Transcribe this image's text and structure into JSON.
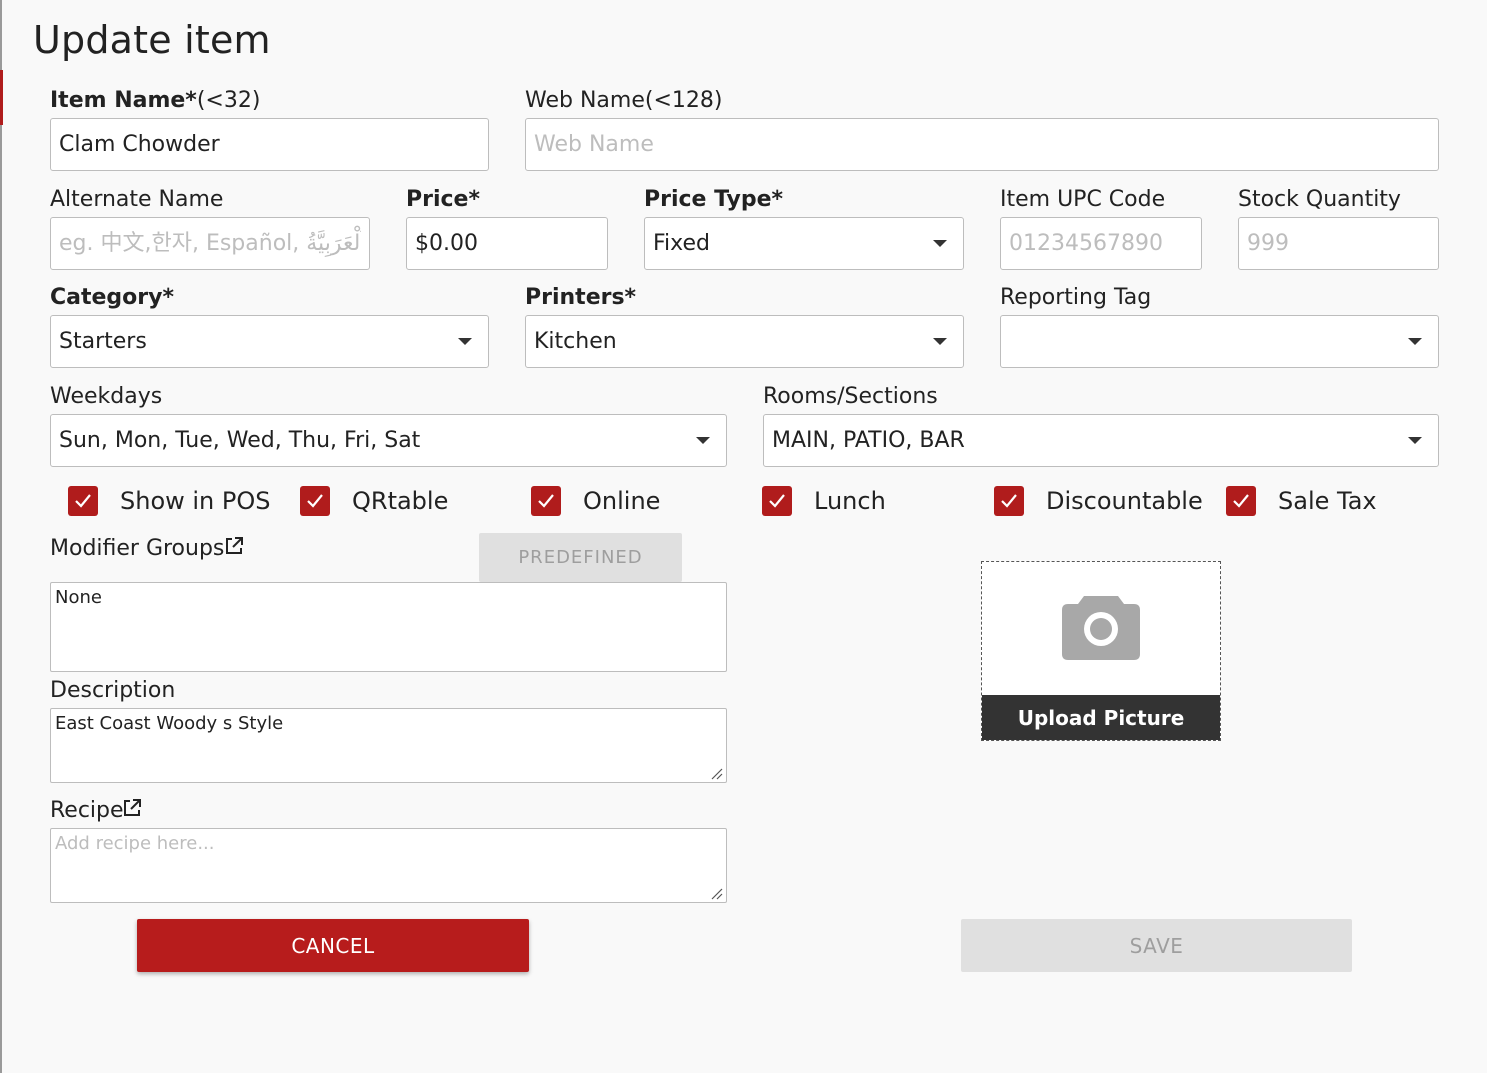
{
  "title": "Update item",
  "labels": {
    "item_name_bold": "Item Name*",
    "item_name_hint": "(<32)",
    "web_name": "Web Name(<128)",
    "alternate_name": "Alternate Name",
    "price": "Price*",
    "price_type": "Price Type*",
    "upc": "Item UPC Code",
    "stock": "Stock Quantity",
    "category": "Category*",
    "printers": "Printers*",
    "reporting_tag": "Reporting Tag",
    "weekdays": "Weekdays",
    "rooms": "Rooms/Sections",
    "modifier_groups": "Modifier Groups",
    "description": "Description",
    "recipe": "Recipe"
  },
  "fields": {
    "item_name": "Clam Chowder",
    "web_name_placeholder": "Web Name",
    "alternate_name_placeholder": "eg. 中文,한자, Español, اَلْعَرَبِيَّةُ",
    "price": "$0.00",
    "upc_placeholder": "01234567890",
    "stock_placeholder": "999",
    "price_type": "Fixed",
    "category": "Starters",
    "printers": "Kitchen",
    "reporting_tag": "",
    "weekdays": "Sun, Mon, Tue, Wed, Thu, Fri, Sat",
    "rooms": "MAIN, PATIO, BAR",
    "modifier_groups": "None",
    "description": "East Coast Woody s Style",
    "recipe_placeholder": "Add recipe here..."
  },
  "checkboxes": [
    {
      "label": "Show in POS",
      "checked": true
    },
    {
      "label": "QRtable",
      "checked": true
    },
    {
      "label": "Online",
      "checked": true
    },
    {
      "label": "Lunch",
      "checked": true
    },
    {
      "label": "Discountable",
      "checked": true
    },
    {
      "label": "Sale Tax",
      "checked": true
    }
  ],
  "buttons": {
    "predefined": "PREDEFINED",
    "upload": "Upload Picture",
    "cancel": "CANCEL",
    "save": "SAVE"
  },
  "colors": {
    "accent": "#b71c1c",
    "disabled_bg": "#e0e0e0",
    "disabled_text": "#9e9e9e",
    "upload_bar": "#333333"
  },
  "icons": {
    "external_link": "external-link-icon",
    "camera": "camera-icon",
    "dropdown": "chevron-down-icon",
    "checkmark": "checkmark-icon"
  }
}
